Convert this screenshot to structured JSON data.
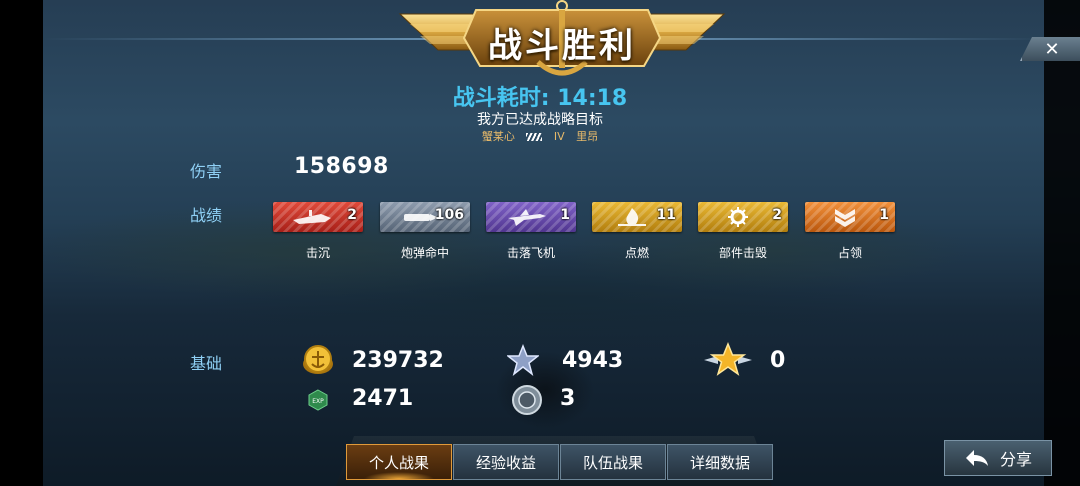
{
  "banner": {
    "title": "战斗胜利"
  },
  "close": {
    "icon": "close-icon",
    "glyph": "✕"
  },
  "battle": {
    "duration": "战斗耗时: 14:18",
    "objective": "我方已达成战略目标",
    "player_name": "蟹某心",
    "ship_tier": "IV",
    "ship_name": "里昂"
  },
  "damage": {
    "label": "伤害",
    "value": "158698"
  },
  "achievements": {
    "label": "战绩",
    "items": [
      {
        "name": "击沉",
        "count": "2",
        "color": "#c8322a",
        "icon": "sinking-ship-icon"
      },
      {
        "name": "炮弹命中",
        "count": "106",
        "color": "#6f7f92",
        "icon": "shell-icon"
      },
      {
        "name": "击落飞机",
        "count": "1",
        "color": "#6a4bb0",
        "icon": "aircraft-icon"
      },
      {
        "name": "点燃",
        "count": "11",
        "color": "#d6a21c",
        "icon": "fire-icon"
      },
      {
        "name": "部件击毁",
        "count": "2",
        "color": "#d6a21c",
        "icon": "gear-icon"
      },
      {
        "name": "占领",
        "count": "1",
        "color": "#e27a1a",
        "icon": "chevron-icon"
      }
    ]
  },
  "base": {
    "label": "基础",
    "coins": "239732",
    "exp": "2471",
    "exp_icon_text": "EXP",
    "star": "4943",
    "medal": "3",
    "gold_star": "0"
  },
  "tabs": [
    {
      "label": "个人战果",
      "active": true
    },
    {
      "label": "经验收益",
      "active": false
    },
    {
      "label": "队伍战果",
      "active": false
    },
    {
      "label": "详细数据",
      "active": false
    }
  ],
  "share": {
    "label": "分享",
    "icon": "share-arrow-icon"
  }
}
